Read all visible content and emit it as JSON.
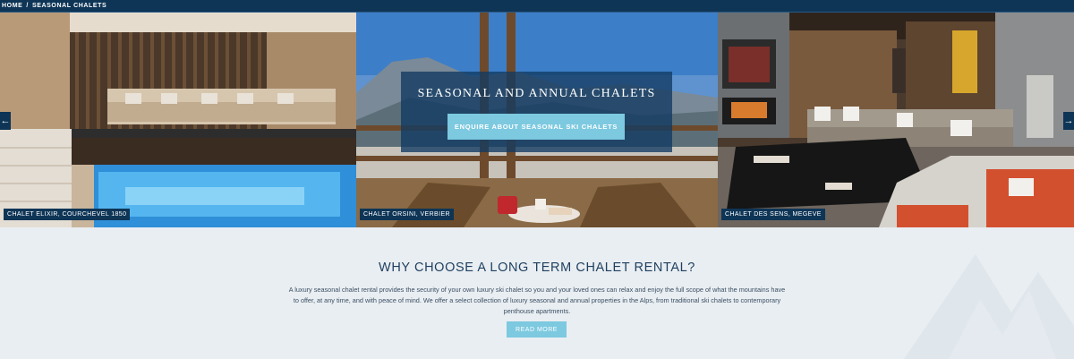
{
  "breadcrumb": {
    "home": "HOME",
    "separator": "/",
    "current": "SEASONAL CHALETS"
  },
  "slider": {
    "slides": [
      {
        "caption": "CHALET ELIXIR, COURCHEVEL 1850"
      },
      {
        "caption": "CHALET ORSINI, VERBIER"
      },
      {
        "caption": "CHALET DES SENS, MEGEVE"
      }
    ],
    "hero": {
      "title": "SEASONAL AND ANNUAL CHALETS",
      "cta_label": "ENQUIRE ABOUT SEASONAL SKI CHALETS"
    },
    "prev_icon": "arrow-left-icon",
    "next_icon": "arrow-right-icon"
  },
  "why": {
    "title": "WHY CHOOSE A LONG TERM CHALET RENTAL?",
    "body": "A luxury seasonal chalet rental provides the security of your own luxury ski chalet so you and your loved ones can relax and enjoy the full scope of what the mountains have to offer, at any time, and with peace of mind. We offer a select collection of luxury seasonal and annual properties in the Alps, from traditional ski chalets to contemporary penthouse apartments.",
    "read_more_label": "READ MORE"
  },
  "colors": {
    "navy": "#0e3556",
    "accent": "#7cc9e0",
    "background": "#e9eef2",
    "heading": "#1e3f5f"
  }
}
